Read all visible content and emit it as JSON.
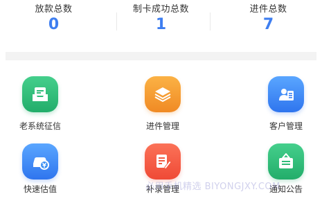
{
  "stats": [
    {
      "label": "放款总数",
      "value": "0"
    },
    {
      "label": "制卡成功总数",
      "value": "1"
    },
    {
      "label": "进件总数",
      "value": "7"
    }
  ],
  "menu": [
    {
      "label": "老系统征信",
      "icon": "inbox-icon",
      "color": "#2fbc78"
    },
    {
      "label": "进件管理",
      "icon": "layers-icon",
      "color": "#f59a2e"
    },
    {
      "label": "客户管理",
      "icon": "customer-card-icon",
      "color": "#3b82f6"
    },
    {
      "label": "快速估值",
      "icon": "car-coin-icon",
      "color": "#3b8ff4"
    },
    {
      "label": "补录管理",
      "icon": "edit-document-icon",
      "color": "#f25a42"
    },
    {
      "label": "通知公告",
      "icon": "notice-board-icon",
      "color": "#2fbc78"
    }
  ],
  "watermark": "必用手机精选 BIYONGJXY.COM"
}
